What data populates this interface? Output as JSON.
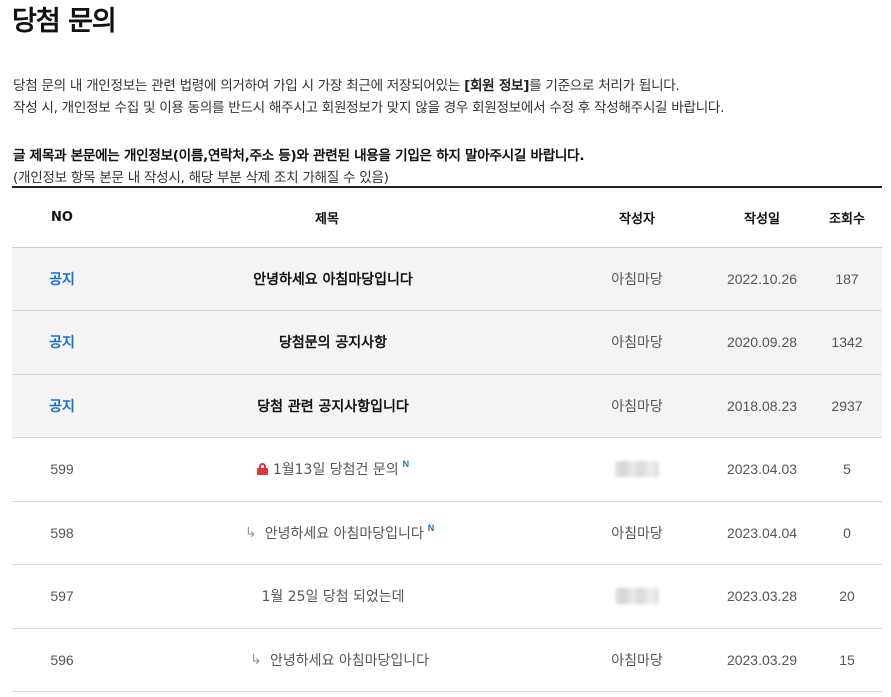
{
  "page": {
    "title": "당첨 문의"
  },
  "notice": {
    "line1_before": "당첨 문의 내 개인정보는 관련 법령에 의거하여 가입 시 가장 최근에 저장되어있는 ",
    "line1_bold": "[회원 정보]",
    "line1_after": "를 기준으로 처리가 됩니다.",
    "line2": "작성 시, 개인정보 수집 및 이용 동의를 반드시 해주시고 회원정보가 맞지 않을 경우 회원정보에서 수정 후 작성해주시길 바랍니다.",
    "warning": "글 제목과 본문에는 개인정보(이름,연락처,주소 등)와 관련된 내용을 기입은 하지 말아주시길 바랍니다.",
    "paren": "(개인정보 항목 본문 내 작성시, 해당 부분 삭제 조치 가해질 수 있음)"
  },
  "table": {
    "headers": {
      "no": "NO",
      "title": "제목",
      "writer": "작성자",
      "date": "작성일",
      "hits": "조회수"
    },
    "rows": [
      {
        "no": "공지",
        "title": "안녕하세요 아침마당입니다",
        "writer": "아침마당",
        "date": "2022.10.26",
        "hits": "187"
      },
      {
        "no": "공지",
        "title": "당첨문의 공지사항",
        "writer": "아침마당",
        "date": "2020.09.28",
        "hits": "1342"
      },
      {
        "no": "공지",
        "title": "당첨 관련 공지사항입니다",
        "writer": "아침마당",
        "date": "2018.08.23",
        "hits": "2937"
      },
      {
        "no": "599",
        "title": "1월13일 당첨건 문의",
        "writer": "",
        "date": "2023.04.03",
        "hits": "5",
        "new_badge": "N"
      },
      {
        "no": "598",
        "title": "안녕하세요 아침마당입니다",
        "writer": "아침마당",
        "date": "2023.04.04",
        "hits": "0",
        "new_badge": "N"
      },
      {
        "no": "597",
        "title": "1월 25일 당첨 되었는데",
        "writer": "",
        "date": "2023.03.28",
        "hits": "20"
      },
      {
        "no": "596",
        "title": "안녕하세요 아침마당입니다",
        "writer": "아침마당",
        "date": "2023.03.29",
        "hits": "15"
      }
    ]
  },
  "colors": {
    "notice_no": "#1a6fc1",
    "lock": "#d9363e",
    "new_badge": "#1a6fc1",
    "notice_row_bg": "#f4f4f4"
  },
  "icons": {
    "lock": "lock-icon",
    "reply": "reply-arrow-icon",
    "new": "new-badge-icon"
  }
}
